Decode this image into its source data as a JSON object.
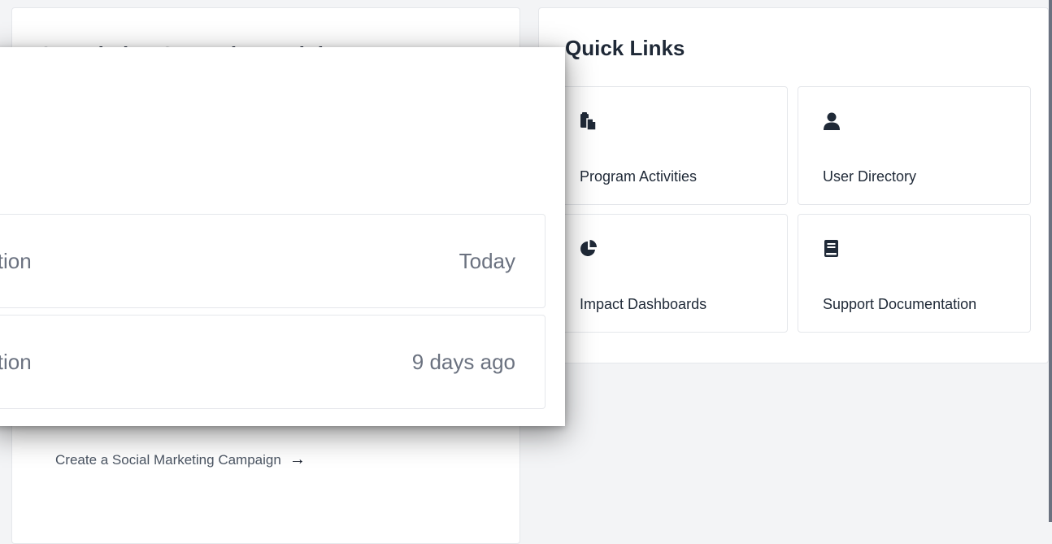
{
  "completion_card": {
    "title": "Completion Status by Module",
    "campaign_link": "Create a Social Marketing Campaign",
    "campaign_arrow": "→"
  },
  "quick_links": {
    "title": "Quick Links",
    "items": [
      {
        "label": "Program Activities",
        "icon": "clipboard-copy-icon"
      },
      {
        "label": "User Directory",
        "icon": "user-icon"
      },
      {
        "label": "Impact Dashboards",
        "icon": "pie-chart-icon"
      },
      {
        "label": "Support Documentation",
        "icon": "book-icon"
      }
    ]
  },
  "popover": {
    "rows": [
      {
        "title": "ition",
        "time": "Today"
      },
      {
        "title": "ition",
        "time": "9 days ago"
      }
    ]
  },
  "colors": {
    "page_background": "#f3f4f6",
    "card_background": "#ffffff",
    "border": "#e5e7eb",
    "muted_text": "#6b7280"
  }
}
